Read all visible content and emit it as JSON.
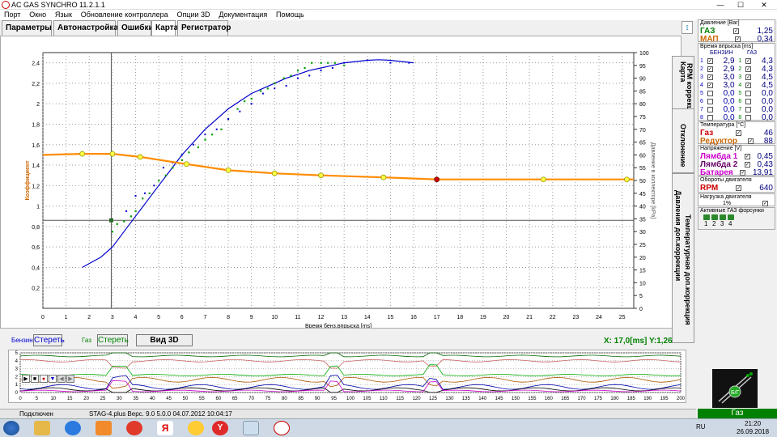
{
  "window": {
    "title": "AC GAS SYNCHRO  11.2.1.1",
    "minimize": "—",
    "maximize": "☐",
    "close": "✕"
  },
  "menu": [
    "Порт",
    "Окно",
    "Язык",
    "Обновление контроллера",
    "Опции 3D",
    "Документация",
    "Помощь"
  ],
  "tabs": [
    "Параметры",
    "Автонастройка",
    "Ошибки",
    "Карта",
    "Регистратор"
  ],
  "right_tabs": [
    "Карта",
    "RPM коррекция",
    "Отклонение",
    "Температурная доп.коррекция",
    "Давления доп.коррекции"
  ],
  "panel": {
    "pressure": {
      "caption": "Давление [Bar]",
      "gas_label": "ГАЗ",
      "gas_value": "1,25",
      "map_label": "МАП",
      "map_value": "0,34"
    },
    "injection": {
      "caption": "Время впрыска [ms]",
      "col_petrol": "БЕНЗИН",
      "col_gas": "ГАЗ",
      "rows": [
        {
          "n": "1",
          "petrol": "2,9",
          "n2": "1",
          "gas": "4,3"
        },
        {
          "n": "2",
          "petrol": "2,9",
          "n2": "2",
          "gas": "4,3"
        },
        {
          "n": "3",
          "petrol": "3,0",
          "n2": "3",
          "gas": "4,5"
        },
        {
          "n": "4",
          "petrol": "3,0",
          "n2": "4",
          "gas": "4,5"
        },
        {
          "n": "5",
          "petrol": "0,0",
          "n2": "5",
          "gas": "0,0"
        },
        {
          "n": "6",
          "petrol": "0,0",
          "n2": "6",
          "gas": "0,0"
        },
        {
          "n": "7",
          "petrol": "0,0",
          "n2": "7",
          "gas": "0,0"
        },
        {
          "n": "8",
          "petrol": "0,0",
          "n2": "8",
          "gas": "0,0"
        }
      ]
    },
    "temperature": {
      "caption": "Температура [°C]",
      "gas_label": "Газ",
      "gas_value": "46",
      "reducer_label": "Редуктор",
      "reducer_value": "88"
    },
    "voltage": {
      "caption": "Напряжение [V]",
      "l1_label": "Лямбда 1",
      "l1_value": "0,45",
      "l2_label": "Лямбда 2",
      "l2_value": "0,43",
      "bat_label": "Батарея",
      "bat_value": "13,91"
    },
    "rpm": {
      "caption": "Обороты двигателя",
      "label": "RPM",
      "value": "640"
    },
    "load": {
      "caption": "Нагрузка двигателя",
      "value": "1%"
    },
    "injectors": {
      "caption": "Активные ГАЗ форсунки",
      "numbers": [
        "1",
        "2",
        "3",
        "4"
      ]
    }
  },
  "bottom": {
    "petrol_label": "Бензин",
    "petrol_clear": "Стереть",
    "gas_label": "Газ",
    "gas_clear": "Стереть",
    "view3d": "Вид 3D",
    "coords": "X: 17,0[ms] Y:1,26"
  },
  "status": {
    "conn": "Подключен",
    "version": "STAG-4.plus   Верс. 9.0  5.0.0    04.07.2012 10:04:17",
    "gas": "Газ"
  },
  "taskbar": {
    "lang": "RU",
    "time": "21:20",
    "date": "26.09.2018"
  },
  "colors": {
    "orange": "#ff8c00",
    "gas_green": "#008000",
    "petrol_blue": "#0000cc",
    "label_orange": "#cc6600",
    "magenta": "#cc00cc"
  },
  "chart_data": {
    "type": "scatter",
    "xlabel": "Время бенз.впрыска [ms]",
    "ylabel_left": "Коэффициент",
    "ylabel_right": "Давление в коллекторе [kPa]",
    "xlim": [
      0,
      25.5
    ],
    "ylim_left": [
      0,
      2.5
    ],
    "ylim_right": [
      0,
      100
    ],
    "x_ticks": [
      0,
      1,
      2,
      3,
      4,
      5,
      6,
      7,
      8,
      9,
      10,
      11,
      12,
      13,
      14,
      15,
      16,
      17,
      18,
      19,
      20,
      21,
      22,
      23,
      24,
      25
    ],
    "y_ticks_left": [
      "0,2",
      "0,4",
      "0,6",
      "0,8",
      "1",
      "1,2",
      "1,4",
      "1,6",
      "1,8",
      "2",
      "2,2",
      "2,4"
    ],
    "y_ticks_right": [
      0,
      5,
      10,
      15,
      20,
      25,
      30,
      35,
      40,
      45,
      50,
      55,
      60,
      65,
      70,
      75,
      80,
      85,
      90,
      95,
      100
    ],
    "cursor": {
      "x": 2.95,
      "y": 0.86
    },
    "coefficient_curve": {
      "name": "Коэффициент",
      "x": [
        0,
        1.7,
        3.0,
        4.2,
        6.2,
        8.0,
        10.0,
        12.0,
        14.7,
        17.0,
        21.6,
        25.5
      ],
      "y": [
        1.5,
        1.51,
        1.51,
        1.48,
        1.41,
        1.35,
        1.32,
        1.3,
        1.28,
        1.26,
        1.26,
        1.26
      ],
      "markers_x": [
        1.7,
        3.0,
        4.2,
        6.2,
        8.0,
        10.0,
        12.0,
        14.7,
        17.0,
        21.6,
        25.2
      ],
      "selected_x": 17.0
    },
    "pressure_curve": {
      "x": [
        1.7,
        2.5,
        3.0,
        3.5,
        4.0,
        4.5,
        5.0,
        5.5,
        6.0,
        6.5,
        7.0,
        7.5,
        8.0,
        8.5,
        9.0,
        9.5,
        10.0,
        10.5,
        11.0,
        11.5,
        12.0,
        12.5,
        13.0,
        13.5,
        14.0,
        14.5,
        15.0,
        15.5,
        16.0
      ],
      "y": [
        16,
        20,
        24,
        30,
        36,
        42,
        48,
        54,
        60,
        65,
        70,
        74,
        78,
        81,
        84,
        86,
        88,
        90,
        91.5,
        93,
        94,
        95,
        96,
        96.5,
        97,
        97.2,
        97,
        96.5,
        96
      ]
    },
    "gas_points": {
      "x": [
        3.0,
        3.2,
        3.5,
        3.8,
        4.0,
        4.3,
        4.6,
        5.0,
        5.3,
        5.6,
        6.0,
        6.3,
        6.7,
        7.0,
        7.3,
        7.7,
        8.0,
        8.4,
        8.7,
        9.0,
        9.4,
        9.7,
        10.0,
        10.4,
        10.7,
        11.0,
        11.3,
        11.6,
        12.0,
        12.3,
        12.6,
        13.0
      ],
      "y": [
        30,
        33,
        34,
        36,
        38,
        43,
        45,
        50,
        52,
        55,
        58,
        61,
        63,
        66,
        68,
        70,
        74,
        78,
        81,
        82,
        85,
        86,
        88,
        90,
        91,
        93,
        94,
        96,
        96,
        96,
        96,
        95
      ]
    },
    "petrol_points": {
      "x": [
        3.6,
        4.0,
        4.4,
        4.8,
        5.2,
        5.6,
        6.0,
        6.5,
        7.0,
        7.5,
        8.0,
        8.5,
        9.0,
        9.5,
        10.0,
        10.5,
        11.0,
        11.5,
        12.0,
        12.5,
        13.0,
        14.0,
        15.0,
        15.8
      ],
      "y": [
        38,
        44,
        45,
        48,
        55,
        57,
        60,
        64,
        68,
        70,
        74,
        77,
        80,
        84,
        86,
        87,
        90,
        91,
        93,
        94,
        96,
        97,
        96,
        96
      ]
    }
  }
}
